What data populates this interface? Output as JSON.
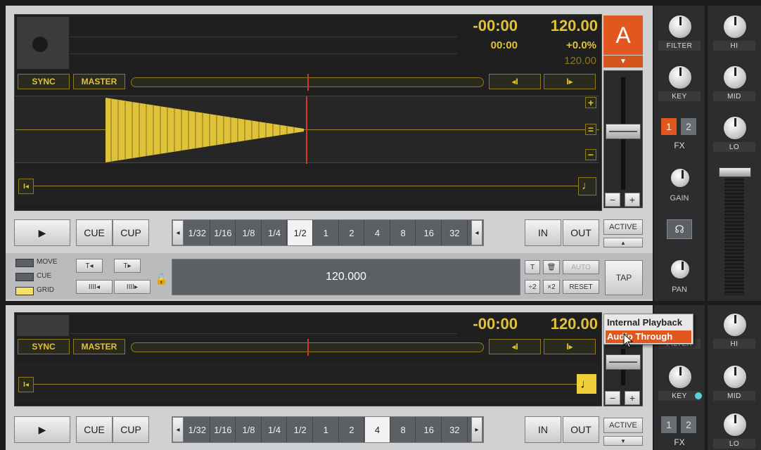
{
  "deckA": {
    "remaining_time": "-00:00",
    "elapsed_time": "00:00",
    "bpm": "120.00",
    "pitch": "+0.0%",
    "orig_bpm": "120.00",
    "letter": "A",
    "sync_label": "SYNC",
    "master_label": "MASTER",
    "nudge_back": "◂I",
    "nudge_fwd": "I▸",
    "zoom_in": "+",
    "zoom_reset": "=",
    "zoom_out": "−",
    "to_start": "I◂",
    "note_icon": "♩",
    "tempo_minus": "−",
    "tempo_plus": "+",
    "play": "▶",
    "cue_label": "CUE",
    "cup_label": "CUP",
    "loop_sizes": [
      "1/32",
      "1/16",
      "1/8",
      "1/4",
      "1/2",
      "1",
      "2",
      "4",
      "8",
      "16",
      "32"
    ],
    "loop_selected": "1/2",
    "loop_prev": "◂",
    "loop_next": "▸",
    "in_label": "IN",
    "out_label": "OUT",
    "active_label": "ACTIVE",
    "active_arrow": "▲"
  },
  "grid": {
    "move_label": "MOVE",
    "cue_label": "CUE",
    "grid_label": "GRID",
    "bpm_value": "120.000",
    "auto_label": "AUTO",
    "half_label": "÷2",
    "double_label": "×2",
    "reset_label": "RESET",
    "tap_label": "TAP"
  },
  "mixerA": {
    "filter_label": "FILTER",
    "key_label": "KEY",
    "fx_label": "FX",
    "fx1": "1",
    "fx2": "2",
    "gain_label": "GAIN",
    "pan_label": "PAN",
    "hi_label": "HI",
    "mid_label": "MID",
    "lo_label": "LO"
  },
  "deckB": {
    "remaining_time": "-00:00",
    "bpm": "120.00",
    "sync_label": "SYNC",
    "master_label": "MASTER",
    "nudge_back": "◂I",
    "nudge_fwd": "I▸",
    "to_start": "I◂",
    "note_icon": "♩",
    "tempo_minus": "−",
    "tempo_plus": "+",
    "play": "▶",
    "cue_label": "CUE",
    "cup_label": "CUP",
    "loop_selected": "4",
    "in_label": "IN",
    "out_label": "OUT",
    "active_label": "ACTIVE",
    "active_arrow": "▼"
  },
  "dropdown": {
    "options": [
      "Internal Playback",
      "Audio Through"
    ],
    "highlighted": "Audio Through"
  },
  "mixerB": {
    "filter_label": "FILTER",
    "key_label": "KEY",
    "fx_label": "FX",
    "fx1": "1",
    "fx2": "2",
    "hi_label": "HI",
    "mid_label": "MID",
    "lo_label": "LO"
  },
  "colors": {
    "accent_yellow": "#e0c239",
    "accent_orange": "#e2571e",
    "panel_light": "#cfd1d3",
    "panel_dark": "#1f1f1f"
  }
}
